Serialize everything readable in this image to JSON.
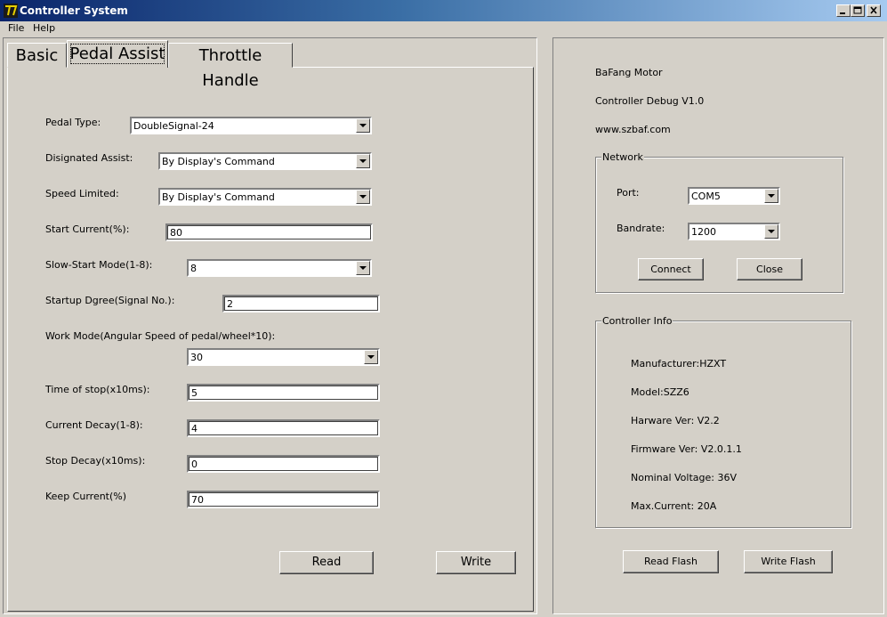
{
  "window": {
    "title": "Controller System",
    "icon": "app-logo-icon",
    "caption_buttons": [
      "minimize-icon",
      "maximize-icon",
      "close-icon"
    ]
  },
  "menu": {
    "file": "File",
    "help": "Help"
  },
  "tabs": {
    "basic": "Basic",
    "pedal_assist": "Pedal Assist",
    "throttle_handle": "Throttle Handle",
    "active": "Pedal Assist"
  },
  "pedal": {
    "pedal_type": {
      "label": "Pedal Type:",
      "value": "DoubleSignal-24"
    },
    "designated_assist": {
      "label": "Disignated Assist:",
      "value": "By Display's Command"
    },
    "speed_limited": {
      "label": "Speed Limited:",
      "value": "By Display's Command"
    },
    "start_current": {
      "label": "Start Current(%):",
      "value": "80"
    },
    "slow_start": {
      "label": "Slow-Start Mode(1-8):",
      "value": "8"
    },
    "startup_degree": {
      "label": "Startup Dgree(Signal No.):",
      "value": "2"
    },
    "work_mode": {
      "label": "Work Mode(Angular Speed of pedal/wheel*10):",
      "value": "30"
    },
    "time_of_stop": {
      "label": "Time of stop(x10ms):",
      "value": "5"
    },
    "current_decay": {
      "label": "Current Decay(1-8):",
      "value": "4"
    },
    "stop_decay": {
      "label": "Stop Decay(x10ms):",
      "value": "0"
    },
    "keep_current": {
      "label": "Keep Current(%)",
      "value": "70"
    },
    "read_button": "Read",
    "write_button": "Write"
  },
  "about": {
    "line1": "BaFang Motor",
    "line2": "Controller Debug V1.0",
    "line3": "www.szbaf.com"
  },
  "network": {
    "legend": "Network",
    "port": {
      "label": "Port:",
      "value": "COM5"
    },
    "baudrate": {
      "label": "Bandrate:",
      "value": "1200"
    },
    "connect_button": "Connect",
    "close_button": "Close"
  },
  "controller_info": {
    "legend": "Controller Info",
    "manufacturer": "Manufacturer:HZXT",
    "model": "Model:SZZ6",
    "hardware": "Harware Ver: V2.2",
    "firmware": "Firmware Ver: V2.0.1.1",
    "voltage": "Nominal Voltage: 36V",
    "max_current": "Max.Current: 20A"
  },
  "flash": {
    "read": "Read Flash",
    "write": "Write Flash"
  }
}
